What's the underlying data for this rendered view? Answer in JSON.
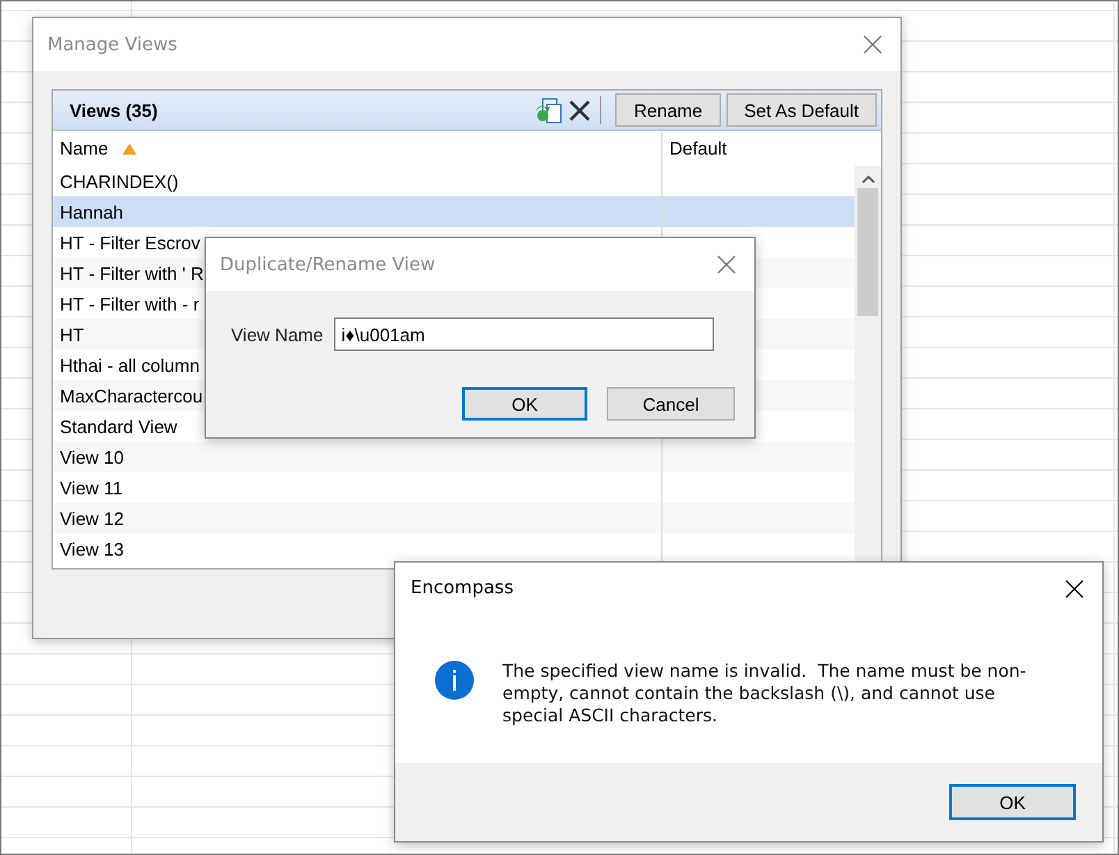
{
  "manage_views": {
    "title": "Manage Views",
    "panel": {
      "title": "Views (35)",
      "buttons": [
        "Rename",
        "Set As Default"
      ]
    },
    "columns": [
      {
        "label": "Name",
        "sorted": true
      },
      {
        "label": "Default",
        "sorted": false
      }
    ],
    "rows": [
      {
        "name": "CHARINDEX()",
        "selected": false
      },
      {
        "name": "Hannah",
        "selected": true
      },
      {
        "name": "HT - Filter Escrov",
        "selected": false
      },
      {
        "name": "HT - Filter with ' R",
        "selected": false
      },
      {
        "name": "HT - Filter with - r",
        "selected": false
      },
      {
        "name": "HT",
        "selected": false
      },
      {
        "name": "Hthai - all column",
        "selected": false
      },
      {
        "name": "MaxCharactercou",
        "selected": false
      },
      {
        "name": "Standard View",
        "selected": false
      },
      {
        "name": "View 10",
        "selected": false
      },
      {
        "name": "View 11",
        "selected": false
      },
      {
        "name": "View 12",
        "selected": false
      },
      {
        "name": "View 13",
        "selected": false
      }
    ]
  },
  "rename_dialog": {
    "title": "Duplicate/Rename View",
    "field": {
      "label": "View Name",
      "value": "i♦\\u001am"
    },
    "buttons": [
      {
        "label": "OK",
        "default": true
      },
      {
        "label": "Cancel",
        "default": false
      }
    ]
  },
  "alert": {
    "title": "Encompass",
    "kind": "info",
    "message": "The specified view name is invalid.  The name must be non-empty, cannot contain the backslash (\\), and cannot use special ASCII characters.",
    "buttons": [
      {
        "label": "OK",
        "default": true
      }
    ]
  }
}
